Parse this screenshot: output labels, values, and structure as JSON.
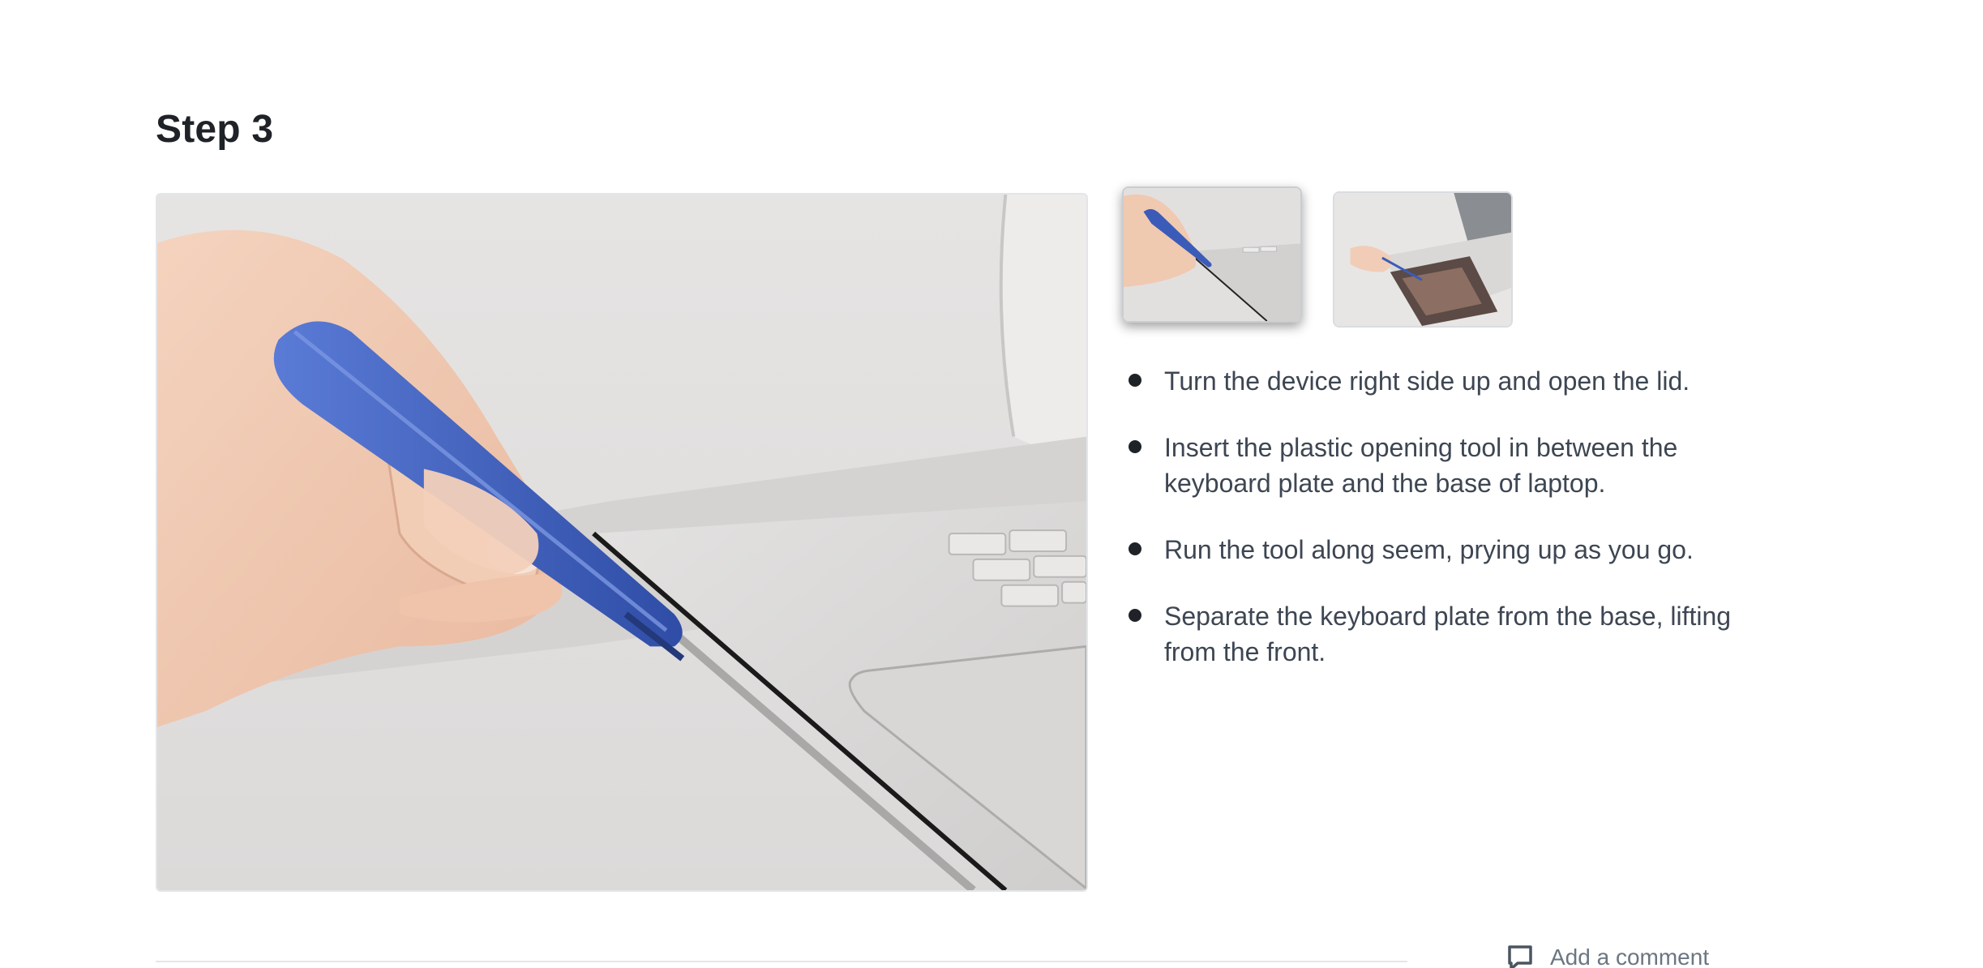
{
  "step": {
    "title": "Step 3"
  },
  "media": {
    "main_image": "laptop-prying-photo",
    "thumbnails": [
      {
        "name": "prying-tool-thumbnail",
        "active": true
      },
      {
        "name": "opened-laptop-thumbnail",
        "active": false
      }
    ]
  },
  "instructions": [
    {
      "text": "Turn the device right side up and open the lid."
    },
    {
      "text": "Insert the plastic opening tool in between the keyboard plate and the base of laptop."
    },
    {
      "text": "Run the tool along seem, prying up as you go."
    },
    {
      "text": "Separate the keyboard plate from the base, lifting from the front."
    }
  ],
  "footer": {
    "comment_label": "Add a comment",
    "comment_icon": "comment-icon"
  },
  "colors": {
    "tool_blue": "#3b5bb8",
    "text": "#3d4652",
    "heading": "#1f2328"
  }
}
